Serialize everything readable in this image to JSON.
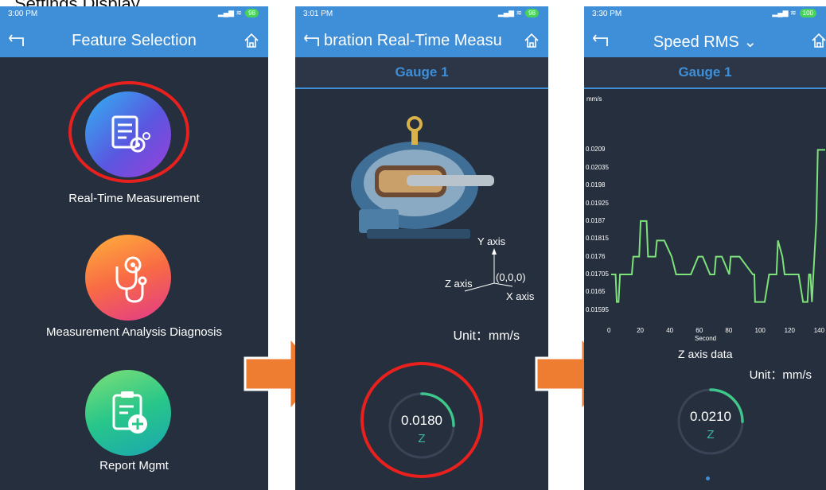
{
  "caption": "Settings Display",
  "screen1": {
    "time": "3:00 PM",
    "battery": "98",
    "title": "Feature Selection",
    "menu": [
      {
        "label": "Real-Time Measurement",
        "icon": "document-gear-icon"
      },
      {
        "label": "Measurement Analysis Diagnosis",
        "icon": "stethoscope-icon"
      },
      {
        "label": "Report Mgmt",
        "icon": "clipboard-add-icon"
      }
    ]
  },
  "screen2": {
    "time": "3:01 PM",
    "battery": "98",
    "title": "bration Real-Time Measu",
    "tab": "Gauge 1",
    "axes": {
      "y": "Y axis",
      "z": "Z axis",
      "x": "X axis",
      "origin": "(0,0,0)"
    },
    "unit": "Unit：mm/s",
    "reading": {
      "value": "0.0180",
      "axis": "Z",
      "fraction": 0.25
    }
  },
  "screen3": {
    "time": "3:30 PM",
    "battery": "100",
    "title": "Speed RMS",
    "tab": "Gauge 1",
    "unit": "Unit：mm/s",
    "reading": {
      "value": "0.0210",
      "axis": "Z",
      "fraction": 0.25
    },
    "chart_title": "Z axis data"
  },
  "colors": {
    "header": "#3e8ed8",
    "bg": "#262f3d",
    "trace": "#7de27a",
    "ring": "#e8201e",
    "arrow": "#ee7d31"
  },
  "chart_data": {
    "type": "line",
    "xlabel": "Second",
    "ylabel": "mm/s",
    "x_ticks": [
      "0",
      "20",
      "40",
      "60",
      "80",
      "100",
      "120",
      "140"
    ],
    "y_ticks": [
      "0.0209",
      "0.02035",
      "0.0198",
      "0.01925",
      "0.0187",
      "0.01815",
      "0.0176",
      "0.01705",
      "0.0165",
      "0.01595"
    ],
    "xlim": [
      0,
      145
    ],
    "ylim": [
      0.0157,
      0.0214
    ],
    "series": [
      {
        "x": [
          0,
          3,
          3.8,
          5,
          6,
          9,
          14,
          15,
          19,
          20,
          24,
          25,
          30,
          31,
          36,
          41,
          44,
          54,
          59,
          62,
          67,
          70,
          71,
          75,
          80,
          81,
          87,
          96,
          97,
          97.5,
          100,
          104,
          107,
          112,
          113,
          116,
          117.5,
          124,
          127,
          130,
          133,
          134,
          135,
          136,
          137,
          139,
          140,
          145
        ],
        "y": [
          0.01705,
          0.01705,
          0.0162,
          0.0162,
          0.01705,
          0.01705,
          0.01705,
          0.0176,
          0.0176,
          0.0187,
          0.0187,
          0.0176,
          0.0176,
          0.0181,
          0.0181,
          0.0176,
          0.01705,
          0.01705,
          0.0176,
          0.0176,
          0.01705,
          0.01705,
          0.0176,
          0.0176,
          0.01705,
          0.0176,
          0.0176,
          0.01705,
          0.01705,
          0.0162,
          0.0162,
          0.0162,
          0.01705,
          0.01705,
          0.0181,
          0.0176,
          0.01705,
          0.01705,
          0.01705,
          0.0162,
          0.0162,
          0.01705,
          0.01705,
          0.0162,
          0.01705,
          0.0187,
          0.0209,
          0.0209
        ]
      }
    ]
  }
}
